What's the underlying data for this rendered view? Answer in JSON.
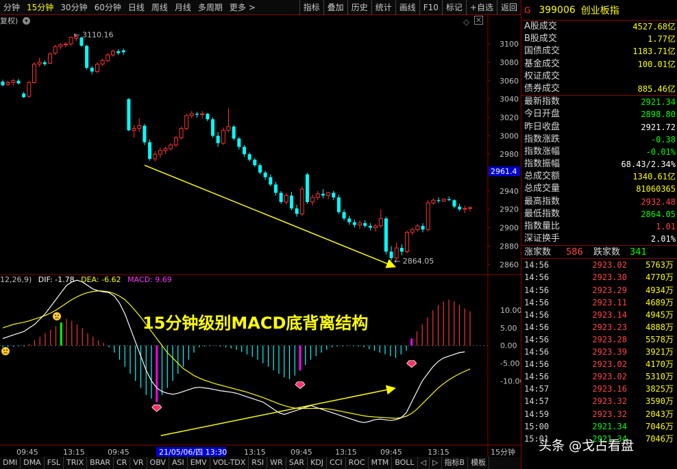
{
  "toolbar": {
    "periods": [
      "分钟",
      "15分钟",
      "30分钟",
      "60分钟",
      "日线",
      "周线",
      "月线",
      "多周期",
      "更多 >"
    ],
    "active_index": 1,
    "right_buttons": [
      "指标",
      "叠加",
      "历史",
      "统计",
      "画线",
      "F10",
      "标记",
      "+自选",
      "返回"
    ]
  },
  "subbar": {
    "fuquan": "复权)",
    "macd_params": "12,26,9)",
    "dif": "DIF: -1.78",
    "dea": "DEA: -6.62",
    "macd": "MACD: 9.69"
  },
  "chart_data": [
    {
      "type": "candlestick",
      "price_axis": {
        "ylim": [
          2852,
          3118
        ],
        "ticks": [
          2860,
          2880,
          2900,
          2920,
          2940,
          2960,
          2980,
          3000,
          3020,
          3040,
          3060,
          3080,
          3100
        ]
      },
      "current_price_tag": "2961.4",
      "high_label": "3110.16",
      "low_label": "2864.05",
      "colors": {
        "up": "#ff3232",
        "down": "#00ffff"
      },
      "ohlc": [
        [
          3059,
          3061,
          3054,
          3055
        ],
        [
          3056,
          3060,
          3054,
          3058
        ],
        [
          3058,
          3062,
          3055,
          3060
        ],
        [
          3060,
          3062,
          3056,
          3057
        ],
        [
          3046,
          3048,
          3041,
          3042
        ],
        [
          3043,
          3060,
          3041,
          3058
        ],
        [
          3058,
          3080,
          3057,
          3078
        ],
        [
          3078,
          3085,
          3075,
          3080
        ],
        [
          3080,
          3082,
          3076,
          3078
        ],
        [
          3079,
          3091,
          3078,
          3089
        ],
        [
          3090,
          3099,
          3088,
          3097
        ],
        [
          3097,
          3101,
          3094,
          3099
        ],
        [
          3099,
          3102,
          3096,
          3100
        ],
        [
          3100,
          3108,
          3098,
          3107
        ],
        [
          3106,
          3110.16,
          3103,
          3108
        ],
        [
          3107,
          3108,
          3097,
          3098
        ],
        [
          3098,
          3099,
          3072,
          3074
        ],
        [
          3074,
          3076,
          3067,
          3070
        ],
        [
          3070,
          3080,
          3068,
          3078
        ],
        [
          3078,
          3084,
          3076,
          3082
        ],
        [
          3082,
          3090,
          3080,
          3088
        ],
        [
          3088,
          3094,
          3086,
          3092
        ],
        [
          3092,
          3094,
          3088,
          3090
        ],
        [
          3093,
          3095,
          3088,
          3091
        ],
        [
          3040,
          3041,
          3005,
          3006
        ],
        [
          3006,
          3012,
          2998,
          3008
        ],
        [
          3008,
          3019,
          3004,
          3011
        ],
        [
          3011,
          3013,
          2990,
          2993
        ],
        [
          2993,
          2996,
          2973,
          2975
        ],
        [
          2975,
          2983,
          2972,
          2980
        ],
        [
          2980,
          2987,
          2976,
          2984
        ],
        [
          2984,
          2988,
          2980,
          2986
        ],
        [
          2986,
          2992,
          2984,
          2990
        ],
        [
          2990,
          3000,
          2988,
          2998
        ],
        [
          2998,
          3010,
          2996,
          3008
        ],
        [
          3008,
          3024,
          3006,
          3022
        ],
        [
          3022,
          3027,
          3019,
          3024
        ],
        [
          3024,
          3026,
          3020,
          3023
        ],
        [
          3023,
          3027,
          3019,
          3024
        ],
        [
          3024,
          3025,
          3016,
          3018
        ],
        [
          3018,
          3020,
          2998,
          3000
        ],
        [
          3000,
          3004,
          2988,
          2992
        ],
        [
          2992,
          3009,
          2990,
          3006
        ],
        [
          3006,
          3030,
          3004,
          3010
        ],
        [
          3010,
          3012,
          2995,
          2997
        ],
        [
          2997,
          2999,
          2985,
          2988
        ],
        [
          2988,
          2990,
          2977,
          2980
        ],
        [
          2980,
          2982,
          2972,
          2974
        ],
        [
          2974,
          2976,
          2966,
          2968
        ],
        [
          2968,
          2970,
          2958,
          2960
        ],
        [
          2960,
          2962,
          2952,
          2955
        ],
        [
          2955,
          2958,
          2945,
          2947
        ],
        [
          2947,
          2950,
          2935,
          2938
        ],
        [
          2938,
          2940,
          2926,
          2928
        ],
        [
          2928,
          2938,
          2925,
          2935
        ],
        [
          2935,
          2939,
          2919,
          2921
        ],
        [
          2921,
          2925,
          2912,
          2915
        ],
        [
          2915,
          2945,
          2913,
          2942
        ],
        [
          2958,
          2960,
          2926,
          2928
        ],
        [
          2928,
          2936,
          2924,
          2933
        ],
        [
          2933,
          2940,
          2930,
          2937
        ],
        [
          2937,
          2942,
          2932,
          2935
        ],
        [
          2935,
          2939,
          2931,
          2938
        ],
        [
          2938,
          2940,
          2930,
          2933
        ],
        [
          2933,
          2936,
          2915,
          2917
        ],
        [
          2917,
          2920,
          2908,
          2910
        ],
        [
          2910,
          2913,
          2903,
          2906
        ],
        [
          2906,
          2909,
          2900,
          2903
        ],
        [
          2903,
          2908,
          2899,
          2905
        ],
        [
          2905,
          2908,
          2900,
          2902
        ],
        [
          2902,
          2905,
          2897,
          2900
        ],
        [
          2900,
          2904,
          2896,
          2902
        ],
        [
          2902,
          2920,
          2900,
          2910
        ],
        [
          2910,
          2912,
          2871,
          2874
        ],
        [
          2874,
          2880,
          2864.05,
          2867
        ],
        [
          2867,
          2884,
          2865,
          2878
        ],
        [
          2878,
          2882,
          2870,
          2874
        ],
        [
          2874,
          2897,
          2872,
          2895
        ],
        [
          2895,
          2900,
          2892,
          2898
        ],
        [
          2898,
          2904,
          2896,
          2902
        ],
        [
          2902,
          2905,
          2895,
          2898
        ],
        [
          2898,
          2930,
          2896,
          2927
        ],
        [
          2927,
          2932,
          2925,
          2930
        ],
        [
          2930,
          2933,
          2927,
          2929
        ],
        [
          2929,
          2932,
          2928,
          2931
        ],
        [
          2931,
          2934,
          2929,
          2930
        ],
        [
          2930,
          2931,
          2921,
          2923
        ],
        [
          2923,
          2926,
          2918,
          2920
        ],
        [
          2920,
          2924,
          2916,
          2921
        ],
        [
          2921,
          2923,
          2918,
          2922
        ]
      ]
    },
    {
      "type": "macd",
      "ylim": [
        -27,
        17
      ],
      "ticks": [
        10.0,
        5.0,
        0.0,
        -5.0,
        -10.0
      ],
      "macd_hist": [
        -0.5,
        -0.4,
        -0.3,
        -0.2,
        -0.3,
        0.5,
        1.5,
        2.5,
        3.5,
        4.5,
        5.5,
        6.5,
        7.5,
        7.0,
        6.0,
        5.0,
        3.5,
        2.5,
        1.5,
        0.8,
        -0.5,
        -2,
        -4,
        -6,
        -8,
        -10,
        -12,
        -14,
        -15,
        -16,
        -14,
        -12,
        -10,
        -8,
        -6,
        -4,
        -2,
        -0.5,
        -0.3,
        -0.2,
        -0.1,
        -0.3,
        -0.5,
        -0.8,
        -1.2,
        -1.8,
        -2.5,
        -3.2,
        -4,
        -5,
        -6,
        -7,
        -8,
        -9,
        -9.5,
        -8.5,
        -7,
        -5.5,
        -4,
        -3,
        -2,
        -1.2,
        -0.5,
        -0.3,
        -0.2,
        -0.1,
        -0.2,
        -0.3,
        -0.5,
        -1.0,
        -1.5,
        -2.0,
        -2.5,
        -3.0,
        -3.5,
        -2.5,
        -1.5,
        2.0,
        4.0,
        6.0,
        8.0,
        10.0,
        11.5,
        12.5,
        13.0,
        12.5,
        11.5,
        10.5,
        9.7
      ],
      "dif": [
        2,
        2.5,
        3,
        3.5,
        4,
        5,
        6,
        7.5,
        9,
        11,
        13,
        15,
        17,
        18,
        18.5,
        18,
        17,
        16,
        15.5,
        15.2,
        15,
        14,
        12,
        9,
        5,
        1,
        -3,
        -7,
        -10,
        -12,
        -13,
        -13.5,
        -13.8,
        -13.5,
        -13,
        -12.5,
        -12,
        -11.8,
        -12,
        -12.2,
        -12.5,
        -12.8,
        -13,
        -13.2,
        -13.5,
        -14,
        -14.5,
        -15,
        -15.5,
        -16,
        -17,
        -18,
        -19,
        -19.5,
        -19,
        -18.5,
        -18,
        -17.5,
        -17,
        -17.5,
        -18,
        -18.5,
        -19,
        -19.5,
        -20,
        -20.5,
        -21,
        -21.5,
        -21.8,
        -21.5,
        -21,
        -20.8,
        -21,
        -21.2,
        -21,
        -20.5,
        -19,
        -16,
        -13,
        -10,
        -8,
        -6,
        -4.5,
        -3.5,
        -3,
        -2.5,
        -2,
        -1.78
      ],
      "dea": [
        5,
        5.5,
        6,
        6.3,
        6.6,
        7,
        7.5,
        8,
        8.5,
        9.2,
        10,
        11,
        12,
        13,
        13.8,
        14.5,
        15,
        15.3,
        15.5,
        15.4,
        15.2,
        14.7,
        14,
        13,
        11.5,
        9.8,
        8,
        6,
        4,
        2,
        0,
        -2,
        -3.5,
        -5,
        -6.5,
        -7.5,
        -8.5,
        -9.2,
        -9.8,
        -10.3,
        -10.8,
        -11.2,
        -11.6,
        -12,
        -12.4,
        -12.8,
        -13.2,
        -13.7,
        -14.2,
        -14.7,
        -15.3,
        -15.9,
        -16.5,
        -17,
        -17.4,
        -17.7,
        -17.8,
        -17.8,
        -17.8,
        -17.8,
        -17.8,
        -17.9,
        -18.1,
        -18.4,
        -18.7,
        -19,
        -19.3,
        -19.6,
        -19.9,
        -20.1,
        -20.2,
        -20.3,
        -20.4,
        -20.5,
        -20.6,
        -20.4,
        -20,
        -19.2,
        -18,
        -16.5,
        -15,
        -13.5,
        -12,
        -10.8,
        -9.7,
        -8.8,
        -8,
        -7.3,
        -6.62
      ],
      "colors": {
        "positive": "#ff3232",
        "negative": "#00ffff",
        "dif": "#ffffff",
        "dea": "#ffff00",
        "signal_bar": "#ff00ff"
      }
    }
  ],
  "annotation": {
    "title": "15分钟级别MACD底背离结构"
  },
  "time_axis": {
    "labels": [
      "09:45",
      "13:15",
      "09:45",
      "13:15",
      "09:45",
      "13:15",
      "09:45",
      "13:15"
    ],
    "cursor_label": "21/05/06/四 13:30",
    "period": "15分钟"
  },
  "info_panel": {
    "tag": "G",
    "code": "399006",
    "name": "创业板指",
    "block1": [
      [
        "A股成交",
        "4527.68亿",
        "#ffff00"
      ],
      [
        "B股成交",
        "1.77亿",
        "#ffff00"
      ],
      [
        "国债成交",
        "1183.71亿",
        "#ffff00"
      ],
      [
        "基金成交",
        "100.01亿",
        "#ffff00"
      ],
      [
        "权证成交",
        "",
        ""
      ],
      [
        "债券成交",
        "885.46亿",
        "#ffff00"
      ]
    ],
    "block2": [
      [
        "最新指数",
        "2921.34",
        "#00ff00"
      ],
      [
        "今日开盘",
        "2898.80",
        "#00ff00"
      ],
      [
        "昨日收盘",
        "2921.72",
        "#ffffff"
      ],
      [
        "指数涨跌",
        "-0.38",
        "#00ff00"
      ],
      [
        "指数涨幅",
        "-0.01%",
        "#00ff00"
      ],
      [
        "指数振幅",
        "68.43/2.34%",
        "#ffffff"
      ],
      [
        "总成交额",
        "1340.61亿",
        "#ffff00"
      ],
      [
        "总成交量",
        "81060365",
        "#ffff00"
      ],
      [
        "最高指数",
        "2932.48",
        "#ff4444"
      ],
      [
        "最低指数",
        "2864.05",
        "#00ff00"
      ],
      [
        "指数量比",
        "1.01",
        "#ff4444"
      ],
      [
        "深证换手",
        "2.01%",
        "#ffffff"
      ]
    ],
    "updown": {
      "up_label": "涨家数",
      "up_value": "586",
      "down_label": "跌家数",
      "down_value": "341"
    },
    "ticks": [
      [
        "14:56",
        "2923.02",
        "5763万"
      ],
      [
        "14:56",
        "2923.30",
        "4770万"
      ],
      [
        "14:56",
        "2923.29",
        "4934万"
      ],
      [
        "14:56",
        "2923.11",
        "4689万"
      ],
      [
        "14:56",
        "2923.14",
        "4945万"
      ],
      [
        "14:56",
        "2923.23",
        "4888万"
      ],
      [
        "14:56",
        "2923.28",
        "5578万"
      ],
      [
        "14:56",
        "2923.39",
        "3921万"
      ],
      [
        "14:56",
        "2923.02",
        "4170万"
      ],
      [
        "14:56",
        "2923.02",
        "5310万"
      ],
      [
        "14:57",
        "2923.16",
        "3825万"
      ],
      [
        "14:57",
        "2923.32",
        "3590万"
      ],
      [
        "14:59",
        "2923.32",
        "2043万"
      ],
      [
        "15:00",
        "2921.34",
        "7046万"
      ],
      [
        "15:01",
        "2921.34",
        "7046万"
      ]
    ]
  },
  "bottom_tabs": [
    "DMI",
    "DMA",
    "FSL",
    "TRIX",
    "BRAR",
    "CR",
    "VR",
    "OBV",
    "ASI",
    "EMV",
    "VOL-TDX",
    "RSI",
    "WR",
    "SAR",
    "KDJ",
    "CCI",
    "ROC",
    "MTM",
    "BOLL",
    "◁",
    "▷",
    "指标B",
    "模板"
  ],
  "watermark": "头条 @戈占看盘"
}
